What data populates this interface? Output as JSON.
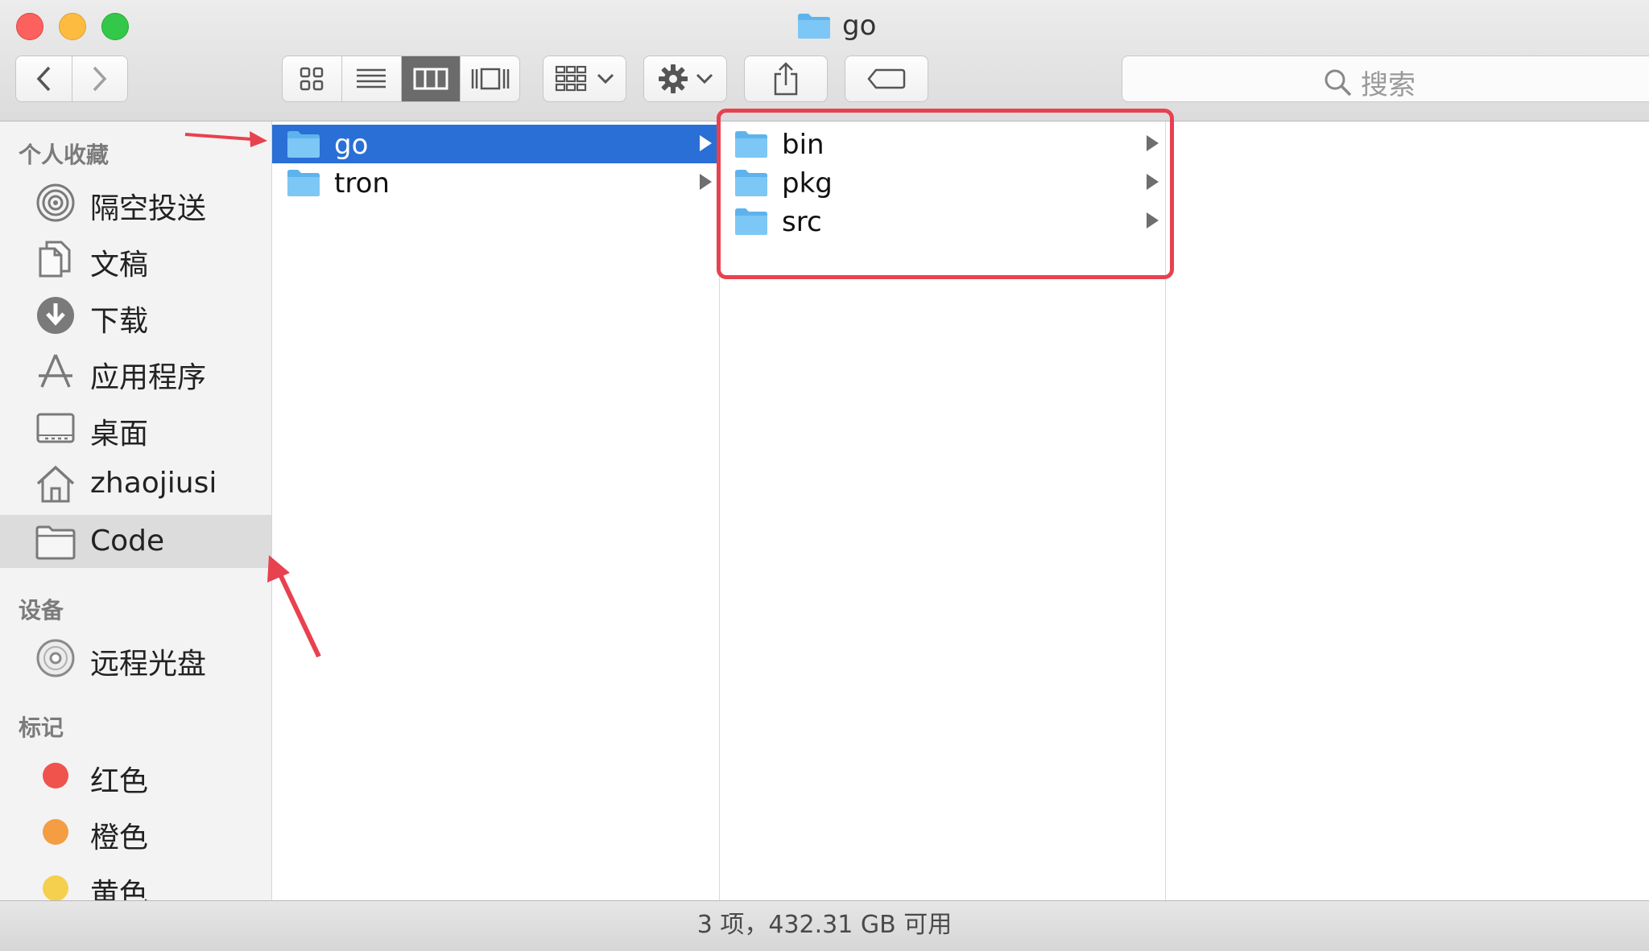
{
  "window": {
    "title": "go",
    "folder_color": "#5fb3ec"
  },
  "toolbar": {
    "back_icon": "chevron-left-icon",
    "forward_icon": "chevron-right-icon",
    "view_modes": [
      "icon-view-icon",
      "list-view-icon",
      "column-view-icon",
      "cover-flow-icon"
    ],
    "active_view": "column-view-icon",
    "arrange_icon": "arrange-grid-icon",
    "action_icon": "gear-icon",
    "share_icon": "share-icon",
    "tag_icon": "tag-icon",
    "search_placeholder": "搜索"
  },
  "sidebar": {
    "favorites_title": "个人收藏",
    "favorites": [
      {
        "label": "隔空投送",
        "icon": "airdrop-icon"
      },
      {
        "label": "文稿",
        "icon": "documents-icon"
      },
      {
        "label": "下载",
        "icon": "download-icon"
      },
      {
        "label": "应用程序",
        "icon": "applications-icon"
      },
      {
        "label": "桌面",
        "icon": "desktop-icon"
      },
      {
        "label": "zhaojiusi",
        "icon": "home-icon"
      },
      {
        "label": "Code",
        "icon": "folder-icon",
        "selected": true
      }
    ],
    "devices_title": "设备",
    "devices": [
      {
        "label": "远程光盘",
        "icon": "remote-disc-icon"
      }
    ],
    "tags_title": "标记",
    "tags": [
      {
        "label": "红色",
        "color": "#f0524c"
      },
      {
        "label": "橙色",
        "color": "#f49d43"
      },
      {
        "label": "黄色",
        "color": "#f5d04f"
      }
    ]
  },
  "columns": {
    "col1": [
      {
        "name": "go",
        "selected": true
      },
      {
        "name": "tron",
        "selected": false
      }
    ],
    "col2": [
      {
        "name": "bin"
      },
      {
        "name": "pkg"
      },
      {
        "name": "src"
      }
    ]
  },
  "status": {
    "text": "3 项，432.31 GB 可用"
  },
  "colors": {
    "selection": "#2a6fd6",
    "annotation_red": "#e8414f"
  }
}
